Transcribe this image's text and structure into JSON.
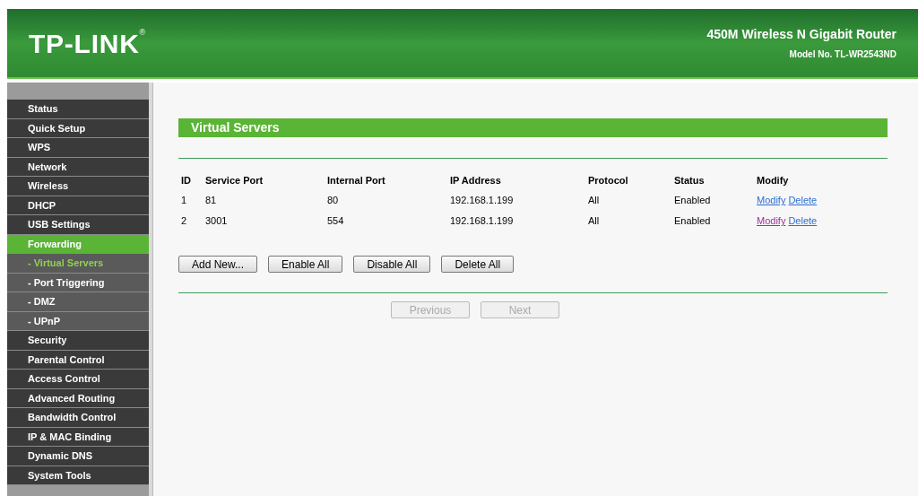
{
  "header": {
    "logo": "TP-LINK",
    "logo_mark": "®",
    "product": "450M Wireless N Gigabit Router",
    "model": "Model No. TL-WR2543ND"
  },
  "sidebar": {
    "items": [
      {
        "label": "Status",
        "selected": false
      },
      {
        "label": "Quick Setup",
        "selected": false
      },
      {
        "label": "WPS",
        "selected": false
      },
      {
        "label": "Network",
        "selected": false
      },
      {
        "label": "Wireless",
        "selected": false
      },
      {
        "label": "DHCP",
        "selected": false
      },
      {
        "label": "USB Settings",
        "selected": false
      },
      {
        "label": "Forwarding",
        "selected": true,
        "children": [
          {
            "label": "- Virtual Servers",
            "selected": true
          },
          {
            "label": "- Port Triggering",
            "selected": false
          },
          {
            "label": "- DMZ",
            "selected": false
          },
          {
            "label": "- UPnP",
            "selected": false
          }
        ]
      },
      {
        "label": "Security",
        "selected": false
      },
      {
        "label": "Parental Control",
        "selected": false
      },
      {
        "label": "Access Control",
        "selected": false
      },
      {
        "label": "Advanced Routing",
        "selected": false
      },
      {
        "label": "Bandwidth Control",
        "selected": false
      },
      {
        "label": "IP & MAC Binding",
        "selected": false
      },
      {
        "label": "Dynamic DNS",
        "selected": false
      },
      {
        "label": "System Tools",
        "selected": false
      }
    ]
  },
  "section": {
    "title": "Virtual Servers"
  },
  "table": {
    "columns": [
      "ID",
      "Service Port",
      "Internal Port",
      "IP Address",
      "Protocol",
      "Status",
      "Modify"
    ],
    "rows": [
      {
        "cells": [
          "1",
          "81",
          "80",
          "192.168.1.199",
          "All",
          "Enabled"
        ],
        "modify": {
          "label": "Modify",
          "visited": false
        },
        "delete": {
          "label": "Delete",
          "visited": false
        }
      },
      {
        "cells": [
          "2",
          "3001",
          "554",
          "192.168.1.199",
          "All",
          "Enabled"
        ],
        "modify": {
          "label": "Modify",
          "visited": true
        },
        "delete": {
          "label": "Delete",
          "visited": false
        }
      }
    ]
  },
  "actions": [
    "Add New...",
    "Enable All",
    "Disable All",
    "Delete All"
  ],
  "pager": [
    {
      "label": "Previous",
      "disabled": true
    },
    {
      "label": "Next",
      "disabled": true
    }
  ]
}
